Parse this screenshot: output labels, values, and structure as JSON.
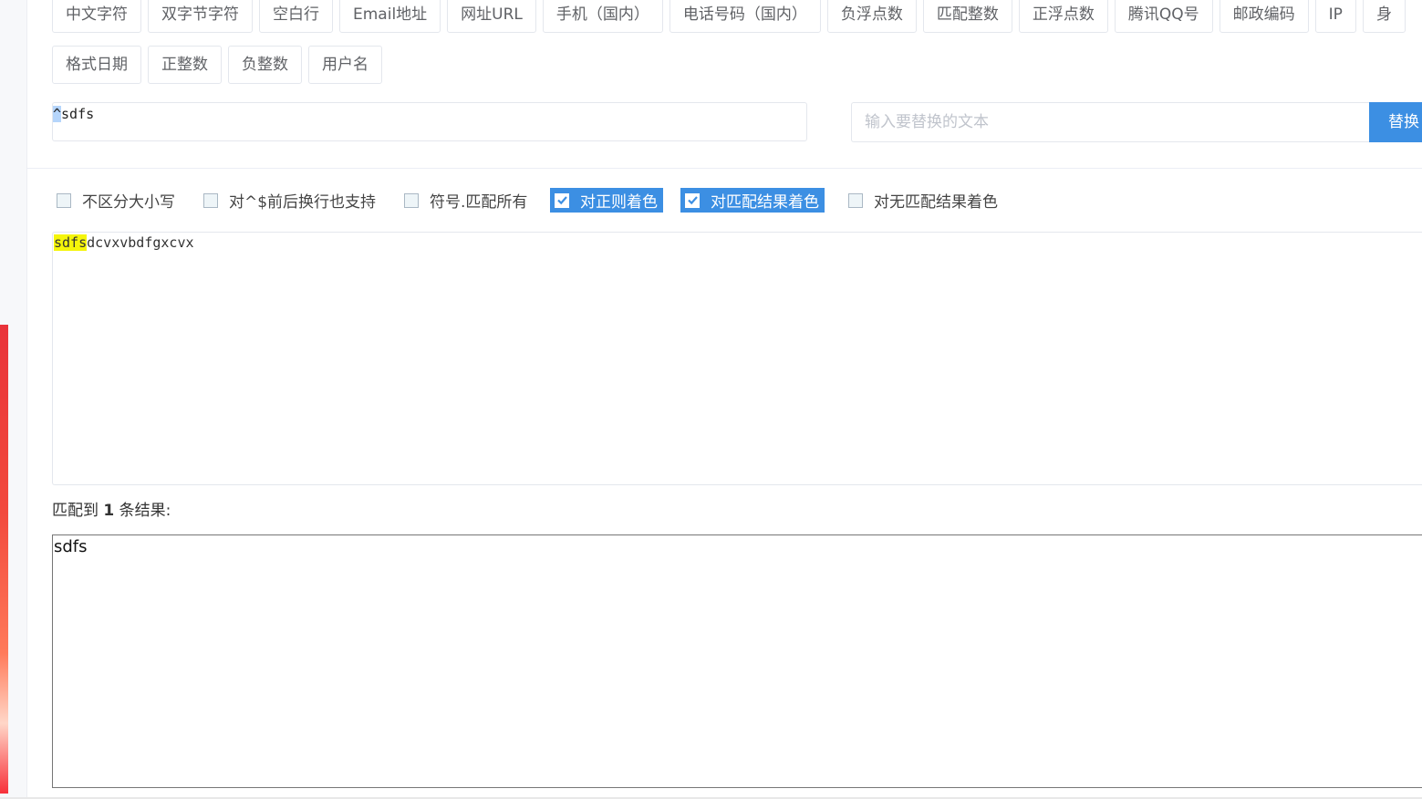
{
  "presets_row1": [
    "中文字符",
    "双字节字符",
    "空白行",
    "Email地址",
    "网址URL",
    "手机（国内）",
    "电话号码（国内）",
    "负浮点数",
    "匹配整数",
    "正浮点数",
    "腾讯QQ号",
    "邮政编码",
    "IP",
    "身"
  ],
  "presets_row2": [
    "格式日期",
    "正整数",
    "负整数",
    "用户名"
  ],
  "regex": {
    "caret": "^",
    "rest": "sdfs"
  },
  "replace": {
    "placeholder": "输入要替换的文本",
    "button_label": "替换"
  },
  "options": [
    {
      "label": "不区分大小写",
      "checked": false
    },
    {
      "label": "对^$前后换行也支持",
      "checked": false
    },
    {
      "label": "符号.匹配所有",
      "checked": false
    },
    {
      "label": "对正则着色",
      "checked": true
    },
    {
      "label": "对匹配结果着色",
      "checked": true
    },
    {
      "label": "对无匹配结果着色",
      "checked": false
    }
  ],
  "test_text": {
    "matched": "sdfs",
    "rest": "dcvxvbdfgxcvx"
  },
  "summary": {
    "prefix": "匹配到 ",
    "count": "1",
    "suffix": " 条结果:"
  },
  "result_text": "sdfs",
  "colors": {
    "accent": "#3c8fe3",
    "highlight": "#f5f50a"
  },
  "icons": {
    "checkbox_checked": "check-icon"
  }
}
